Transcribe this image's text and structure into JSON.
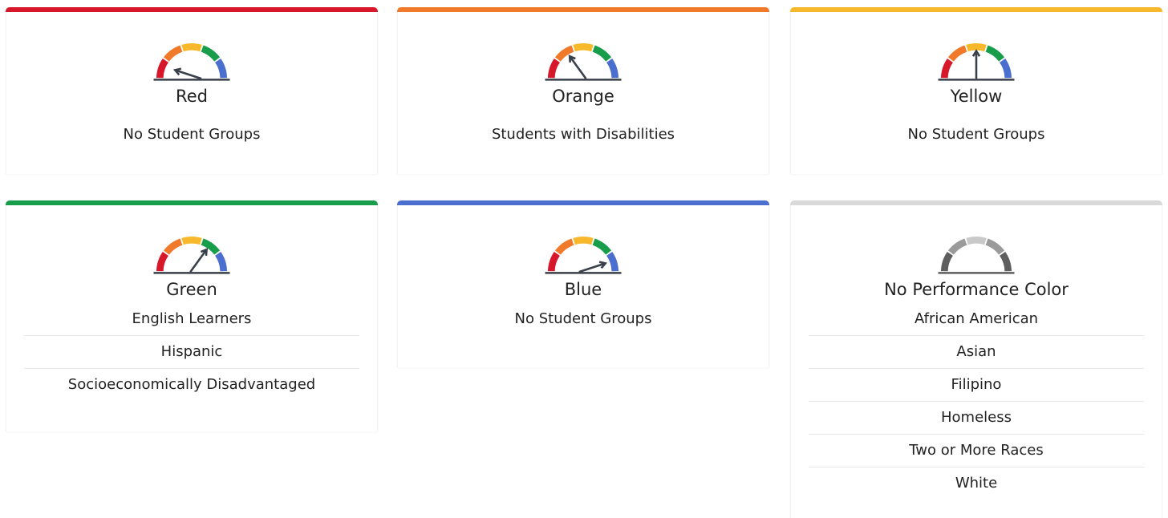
{
  "colors": {
    "red": "#d7182a",
    "orange": "#f0792a",
    "yellow": "#f7b92b",
    "green": "#189e4a",
    "blue": "#4a6fcf",
    "gray": "#d9d9d9",
    "needle": "#3a4049"
  },
  "cards": [
    {
      "id": "red",
      "title": "Red",
      "accent": "#d7182a",
      "level": 1,
      "groups": [
        "No Student Groups"
      ]
    },
    {
      "id": "orange",
      "title": "Orange",
      "accent": "#f0792a",
      "level": 2,
      "groups": [
        "Students with Disabilities"
      ]
    },
    {
      "id": "yellow",
      "title": "Yellow",
      "accent": "#f7b92b",
      "level": 3,
      "groups": [
        "No Student Groups"
      ]
    },
    {
      "id": "green",
      "title": "Green",
      "accent": "#189e4a",
      "level": 4,
      "groups": [
        "English Learners",
        "Hispanic",
        "Socioeconomically Disadvantaged"
      ]
    },
    {
      "id": "blue",
      "title": "Blue",
      "accent": "#4a6fcf",
      "level": 5,
      "groups": [
        "No Student Groups"
      ]
    },
    {
      "id": "none",
      "title": "No Performance Color",
      "accent": "#d9d9d9",
      "level": 0,
      "groups": [
        "African American",
        "Asian",
        "Filipino",
        "Homeless",
        "Two or More Races",
        "White"
      ]
    }
  ]
}
